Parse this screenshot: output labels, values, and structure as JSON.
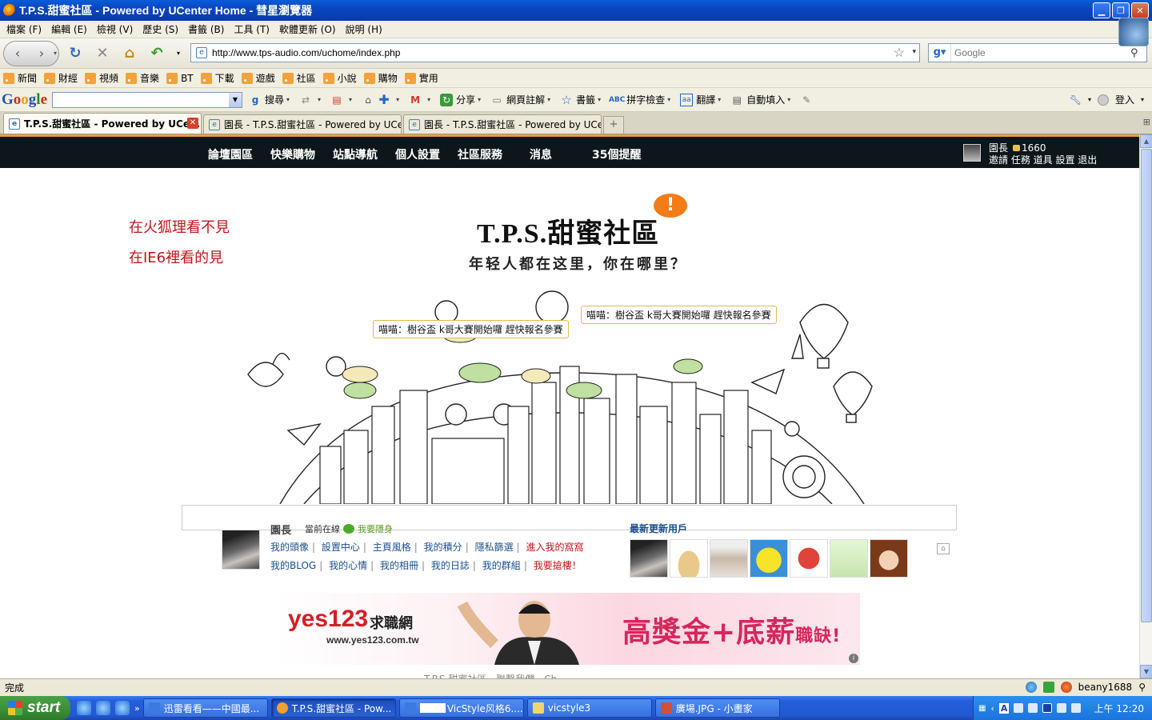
{
  "window": {
    "title": "T.P.S.甜蜜社區 - Powered by UCenter Home - 彗星瀏覽器",
    "min": "▁",
    "max": "❐",
    "close": "✕"
  },
  "menu": [
    "檔案 (F)",
    "編輯 (E)",
    "檢視 (V)",
    "歷史 (S)",
    "書籤 (B)",
    "工具 (T)",
    "軟體更新 (O)",
    "說明 (H)"
  ],
  "nav": {
    "url": "http://www.tps-audio.com/uchome/index.php",
    "search_placeholder": "Google"
  },
  "bookmarks": [
    "新聞",
    "財經",
    "視頻",
    "音樂",
    "BT",
    "下載",
    "遊戲",
    "社區",
    "小說",
    "購物",
    "實用"
  ],
  "google_toolbar": {
    "items": [
      "搜尋",
      "分享",
      "網頁註解",
      "書籤",
      "拼字檢查",
      "翻譯",
      "自動填入"
    ],
    "signin": "登入"
  },
  "tabs": [
    {
      "label": "T.P.S.甜蜜社區 - Powered by UCen...",
      "active": true
    },
    {
      "label": "園長 - T.P.S.甜蜜社區 - Powered by UCent...",
      "active": false
    },
    {
      "label": "園長 - T.P.S.甜蜜社區 - Powered by UCent...",
      "active": false
    }
  ],
  "site": {
    "nav": [
      "論壇園區",
      "快樂購物",
      "站點導航",
      "個人設置",
      "社區服務"
    ],
    "messages": "消息",
    "reminders": "35個提醒",
    "user": {
      "name": "園長",
      "credits": "1660",
      "links": "邀請 任務 道具 設置 退出"
    },
    "note_line1": "在火狐理看不見",
    "note_line2": "在IE6裡看的見",
    "logo": "T.P.S.甜蜜社區",
    "logo_badge": "!",
    "slogan": "年轻人都在这里，你在哪里？",
    "tip1": "喵喵：樹谷盃 k哥大賽開始囉 趕快報名參賽",
    "tip2": "喵喵：樹谷盃 k哥大賽開始囉 趕快報名參賽",
    "profile": {
      "name": "園長",
      "status": "當前在線",
      "hide": "我要隱身",
      "row1": [
        "我的頭像",
        "設置中心",
        "主頁風格",
        "我的積分",
        "隱私篩選"
      ],
      "row1_hot": "進入我的窩窩",
      "row2": [
        "我的BLOG",
        "我的心情",
        "我的相冊",
        "我的日誌",
        "我的群組"
      ],
      "row2_hot": "我要搶樓！"
    },
    "newusers_title": "最新更新用戶",
    "ad": {
      "brand": "yes123",
      "brand2": "求職網",
      "url": "www.yes123.com.tw",
      "slogan": "高獎金+底薪",
      "slogan_small": "職缺!",
      "info": "i"
    },
    "footer_peek": "T.P.S.甜蜜社區 - 聯繫我們 - Ch"
  },
  "status": {
    "text": "完成",
    "user": "beany1688"
  },
  "taskbar": {
    "start": "start",
    "more": "»",
    "buttons": [
      {
        "label": "迅雷看看——中國最...",
        "color": "#3a7be0"
      },
      {
        "label": "T.P.S.甜蜜社區 - Pow...",
        "color": "#f0a030",
        "active": true
      },
      {
        "label": "VicStyle风格6....",
        "color": "#3a7be0"
      },
      {
        "label": "vicstyle3",
        "color": "#f3d56a"
      },
      {
        "label": "廣場.JPG - 小畫家",
        "color": "#d0503a"
      }
    ],
    "time": "上午 12:20",
    "tray_letter": "A"
  },
  "colors": {
    "site_nav_bg": "#0d171b",
    "note_red": "#c0161b",
    "link_blue": "#1c4f8f"
  }
}
